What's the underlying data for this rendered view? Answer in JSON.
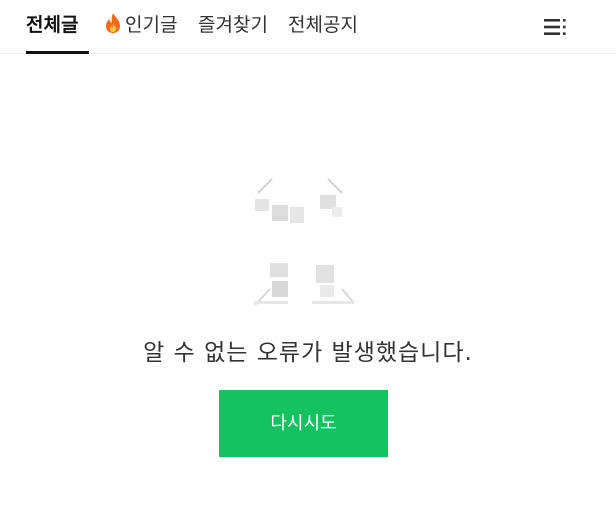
{
  "tabs": [
    {
      "label": "전체글",
      "active": true
    },
    {
      "label": "인기글",
      "icon": "fire-icon",
      "active": false
    },
    {
      "label": "즐겨찾기",
      "active": false
    },
    {
      "label": "전체공지",
      "active": false
    }
  ],
  "menu": {
    "icon": "hamburger-menu-icon"
  },
  "error": {
    "illustration": "error-illustration",
    "message": "알 수 없는 오류가 발생했습니다.",
    "retry_label": "다시시도"
  },
  "colors": {
    "accent": "#14c260",
    "text": "#333333",
    "tab_active": "#111111",
    "divider": "#ececec",
    "fire": "#f26b1d"
  }
}
